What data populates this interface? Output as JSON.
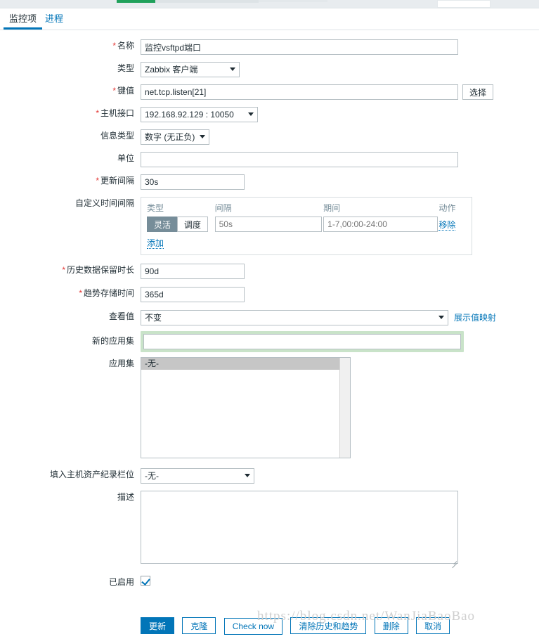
{
  "tabs": [
    {
      "label": "监控项",
      "active": true
    },
    {
      "label": "进程",
      "active": false
    }
  ],
  "form": {
    "name": {
      "label": "名称",
      "required": true,
      "value": "监控vsftpd端口"
    },
    "type": {
      "label": "类型",
      "required": false,
      "value": "Zabbix 客户端"
    },
    "key": {
      "label": "键值",
      "required": true,
      "value": "net.tcp.listen[21]",
      "select_button": "选择"
    },
    "host_interface": {
      "label": "主机接口",
      "required": true,
      "value": "192.168.92.129 : 10050"
    },
    "info_type": {
      "label": "信息类型",
      "required": false,
      "value": "数字 (无正负)"
    },
    "units": {
      "label": "单位",
      "required": false,
      "value": ""
    },
    "update_interval": {
      "label": "更新间隔",
      "required": true,
      "value": "30s"
    },
    "custom_intervals": {
      "label": "自定义时间间隔",
      "required": false,
      "headers": {
        "type": "类型",
        "interval": "间隔",
        "period": "期间",
        "action": "动作"
      },
      "rows": [
        {
          "type_flexible": "灵活",
          "type_scheduling": "调度",
          "type_selected": "灵活",
          "interval_value": "",
          "interval_placeholder": "50s",
          "period_value": "",
          "period_placeholder": "1-7,00:00-24:00",
          "remove_label": "移除"
        }
      ],
      "add_label": "添加"
    },
    "history": {
      "label": "历史数据保留时长",
      "required": true,
      "value": "90d"
    },
    "trends": {
      "label": "趋势存储时间",
      "required": true,
      "value": "365d"
    },
    "show_value": {
      "label": "查看值",
      "required": false,
      "value": "不变",
      "value_map_link": "展示值映射"
    },
    "new_application": {
      "label": "新的应用集",
      "required": false,
      "value": "",
      "focused": true
    },
    "applications": {
      "label": "应用集",
      "required": false,
      "options": [
        "-无-"
      ],
      "selected": "-无-"
    },
    "inventory_field": {
      "label": "填入主机资产纪录栏位",
      "required": false,
      "value": "-无-"
    },
    "description": {
      "label": "描述",
      "required": false,
      "value": ""
    },
    "enabled": {
      "label": "已启用",
      "required": false,
      "checked": true
    }
  },
  "footer": {
    "buttons": [
      {
        "label": "更新",
        "primary": true
      },
      {
        "label": "克隆",
        "primary": false
      },
      {
        "label": "Check now",
        "primary": false
      },
      {
        "label": "清除历史和趋势",
        "primary": false
      },
      {
        "label": "删除",
        "primary": false
      },
      {
        "label": "取消",
        "primary": false
      }
    ]
  },
  "watermark": "https://blog.csdn.net/WanJiaBaoBao",
  "colors": {
    "accent": "#0275b8",
    "required": "#e33734",
    "toggle_selected": "#768d99",
    "focus_ring": "#c9e3c9",
    "header_green": "#20a15b"
  }
}
